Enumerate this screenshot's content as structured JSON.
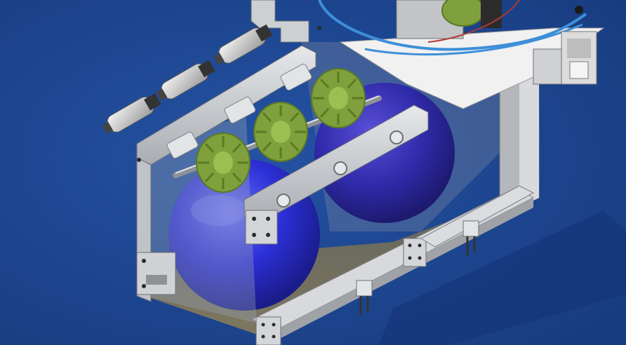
{
  "scene": {
    "subject": "cad-render-ball-shooter-assembly",
    "colors": {
      "background": "#1c4590",
      "background_light": "#2452a3",
      "aluminum": "#c9ccd0",
      "aluminum_dark": "#8e9297",
      "ball": "#2c2fd6",
      "ball_highlight": "#6a70ff",
      "wheel": "#7fa03c",
      "wheel_dark": "#5b7a24",
      "plate": "#f1f1f1",
      "tubing": "#3e8fd8",
      "wire": "#b03a2e",
      "motor": "#e6e6e6"
    },
    "counts": {
      "balls": 2,
      "compliant_wheels": 3,
      "motors": 3
    }
  }
}
